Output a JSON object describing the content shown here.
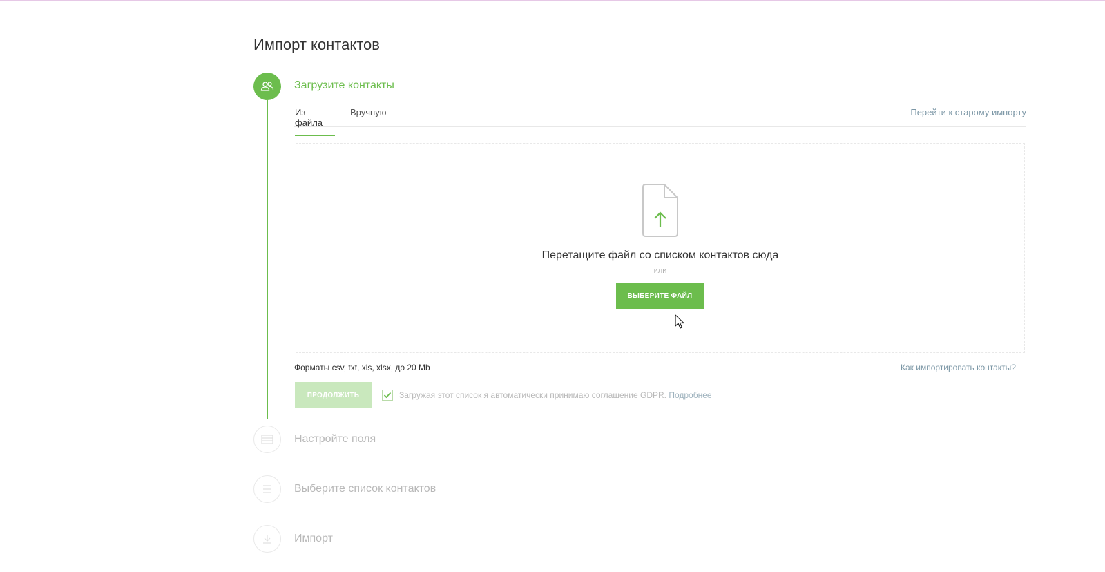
{
  "page": {
    "title": "Импорт контактов"
  },
  "steps": [
    {
      "label": "Загрузите контакты",
      "state": "active",
      "icon": "users-icon"
    },
    {
      "label": "Настройте поля",
      "state": "inactive",
      "icon": "fields-icon"
    },
    {
      "label": "Выберите список контактов",
      "state": "inactive",
      "icon": "list-icon"
    },
    {
      "label": "Импорт",
      "state": "inactive",
      "icon": "download-icon"
    }
  ],
  "tabs": {
    "file_label": "Из файла",
    "manual_label": "Вручную",
    "old_import_link": "Перейти к старому импорту"
  },
  "dropzone": {
    "title": "Перетащите файл со списком контактов сюда",
    "or": "или",
    "choose_button": "ВЫБЕРИТЕ ФАЙЛ"
  },
  "formats": "Форматы csv, txt, xls, xlsx, до 20 Mb",
  "help_link": "Как импортировать контакты?",
  "continue_button": "ПРОДОЛЖИТЬ",
  "gdpr": {
    "checked": true,
    "text": "Загружая этот список я автоматически принимаю соглашение GDPR.",
    "link": "Подробнее"
  },
  "colors": {
    "accent": "#6cbd4d",
    "accent_disabled": "#c9e8bd",
    "link": "#7c97a6",
    "inactive_text": "#b9b9b9"
  }
}
